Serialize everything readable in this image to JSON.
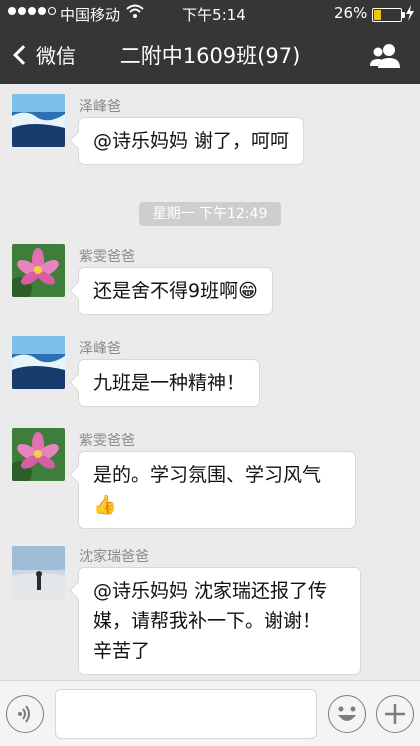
{
  "status_bar": {
    "carrier": "中国移动",
    "time": "下午5:14",
    "battery_percent": "26%",
    "battery_level": 0.26,
    "signal_bars": 4
  },
  "nav": {
    "back_label": "微信",
    "title": "二附中1609班(97)"
  },
  "timestamp": "星期一 下午12:49",
  "messages": [
    {
      "sender": "泽峰爸",
      "lines": [
        "@诗乐妈妈 谢了，呵呵"
      ]
    },
    {
      "sender": "紫雯爸爸",
      "lines": [
        "还是舍不得9班啊😁"
      ]
    },
    {
      "sender": "泽峰爸",
      "lines": [
        "九班是一种精神！"
      ]
    },
    {
      "sender": "紫雯爸爸",
      "lines": [
        "是的。学习氛围、学习风气",
        "👍"
      ]
    },
    {
      "sender": "沈家瑞爸爸",
      "lines": [
        "@诗乐妈妈 沈家瑞还报了传",
        "媒，请帮我补一下。谢谢！",
        "辛苦了"
      ]
    }
  ],
  "icons": {
    "voice": "voice-icon",
    "emoji": "emoji-icon",
    "plus": "plus-icon",
    "people": "people-icon",
    "back": "chevron-left-icon",
    "wifi": "wifi-icon",
    "charging": "charging-icon"
  },
  "colors": {
    "header_bg": "#363636",
    "chat_bg": "#ebebeb",
    "battery_fill": "#f5c400"
  }
}
